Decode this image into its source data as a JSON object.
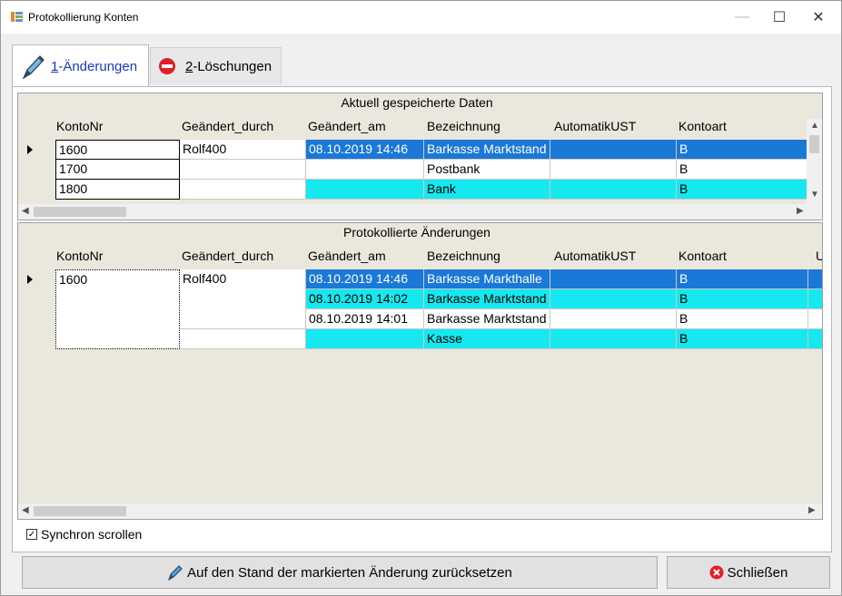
{
  "window": {
    "title": "Protokollierung Konten",
    "min_label": "—",
    "max_label": "☐",
    "close_label": "✕"
  },
  "tabs": [
    {
      "key": "1",
      "label": "-Änderungen",
      "icon": "pen-icon",
      "active": true
    },
    {
      "key": "2",
      "label": "-Löschungen",
      "icon": "no-entry-icon",
      "active": false
    }
  ],
  "grid_current": {
    "caption": "Aktuell gespeicherte Daten",
    "columns": [
      "KontoNr",
      "Geändert_durch",
      "Geändert_am",
      "Bezeichnung",
      "AutomatikUST",
      "Kontoart"
    ],
    "rows": [
      {
        "konto": "1600",
        "durch": "Rolf400",
        "am": "08.10.2019 14:46",
        "bez": "Barkasse Marktstand",
        "ust": "",
        "art": "B",
        "style": "sel"
      },
      {
        "konto": "1700",
        "durch": "",
        "am": "",
        "bez": "Postbank",
        "ust": "",
        "art": "B",
        "style": "white"
      },
      {
        "konto": "1800",
        "durch": "",
        "am": "",
        "bez": "Bank",
        "ust": "",
        "art": "B",
        "style": "cyan"
      }
    ]
  },
  "grid_log": {
    "caption": "Protokollierte Änderungen",
    "columns": [
      "KontoNr",
      "Geändert_durch",
      "Geändert_am",
      "Bezeichnung",
      "AutomatikUST",
      "Kontoart",
      "U"
    ],
    "rows": [
      {
        "konto": "1600",
        "durch": "Rolf400",
        "am": "08.10.2019 14:46",
        "bez": "Barkasse Markthalle",
        "ust": "",
        "art": "B",
        "style": "sel"
      },
      {
        "konto": "",
        "durch": "",
        "am": "08.10.2019 14:02",
        "bez": "Barkasse Marktstand",
        "ust": "",
        "art": "B",
        "style": "cyan"
      },
      {
        "konto": "",
        "durch": "",
        "am": "08.10.2019 14:01",
        "bez": "Barkasse Marktstand",
        "ust": "",
        "art": "B",
        "style": "white"
      },
      {
        "konto": "",
        "durch": "",
        "am": "",
        "bez": "Kasse",
        "ust": "",
        "art": "B",
        "style": "cyan"
      }
    ]
  },
  "sync_scroll": {
    "label": "Synchron scrollen",
    "checked": true,
    "mark": "✓"
  },
  "buttons": {
    "reset": "Auf den Stand der markierten Änderung zurücksetzen",
    "close": "Schließen"
  },
  "colors": {
    "selected": "#1a78d6",
    "cyan": "#15e8ee",
    "grid_bg": "#eae7dd",
    "active_tab_text": "#1a38c0"
  }
}
